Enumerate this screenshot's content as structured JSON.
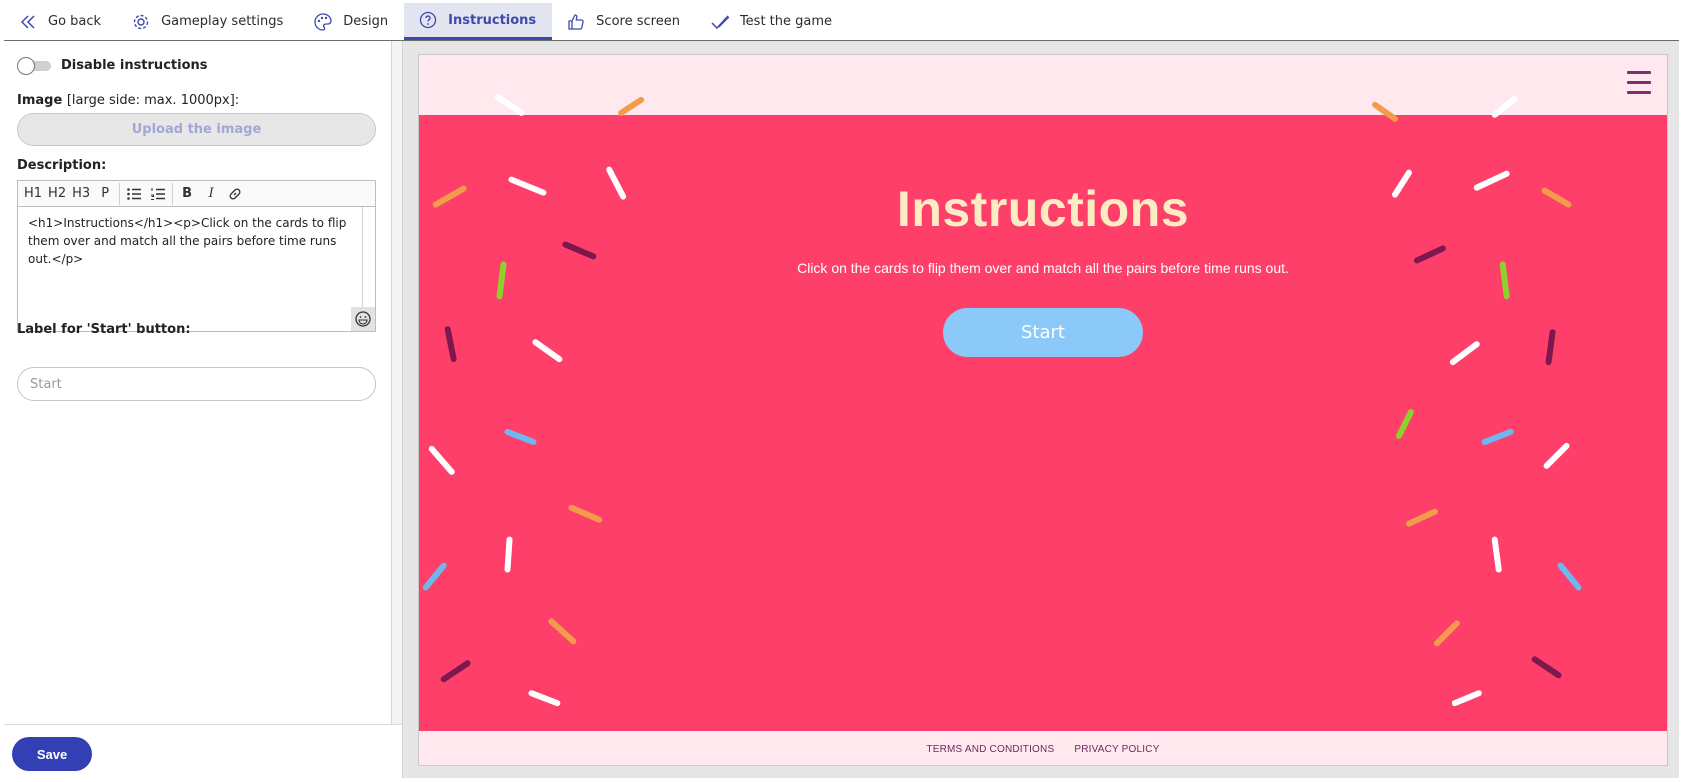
{
  "nav": {
    "items": [
      {
        "label": "Go back",
        "icon": "chevron-left-icon"
      },
      {
        "label": "Gameplay settings",
        "icon": "gear-icon"
      },
      {
        "label": "Design",
        "icon": "palette-icon"
      },
      {
        "label": "Instructions",
        "icon": "question-circle-icon",
        "active": true
      },
      {
        "label": "Score screen",
        "icon": "thumbs-up-icon"
      },
      {
        "label": "Test the game",
        "icon": "check-icon"
      }
    ]
  },
  "panel": {
    "toggle_label": "Disable instructions",
    "toggle_on": false,
    "image_label": "Image",
    "image_hint": "[large side: max. 1000px]:",
    "upload_label": "Upload the image",
    "description_label": "Description:",
    "toolbar": {
      "h1": "H1",
      "h2": "H2",
      "h3": "H3",
      "p": "P",
      "bold": "B",
      "italic": "I"
    },
    "description_text": "<h1>Instructions</h1><p>Click on the cards to flip them over and match all the pairs before time runs out.</p>",
    "start_label": "Label for 'Start' button:",
    "start_placeholder": "Start",
    "save_label": "Save"
  },
  "preview": {
    "title": "Instructions",
    "text": "Click on the cards to flip them over and match all the pairs before time runs out.",
    "start_button": "Start",
    "footer": {
      "terms": "TERMS AND CONDITIONS",
      "privacy": "PRIVACY POLICY"
    }
  },
  "colors": {
    "accent": "#3c4aad",
    "save_button": "#3340b4",
    "preview_background": "#fd3f6a",
    "preview_header": "#ffe9ee",
    "title_color": "#fcecc4",
    "start_button": "#8ac9f8"
  }
}
